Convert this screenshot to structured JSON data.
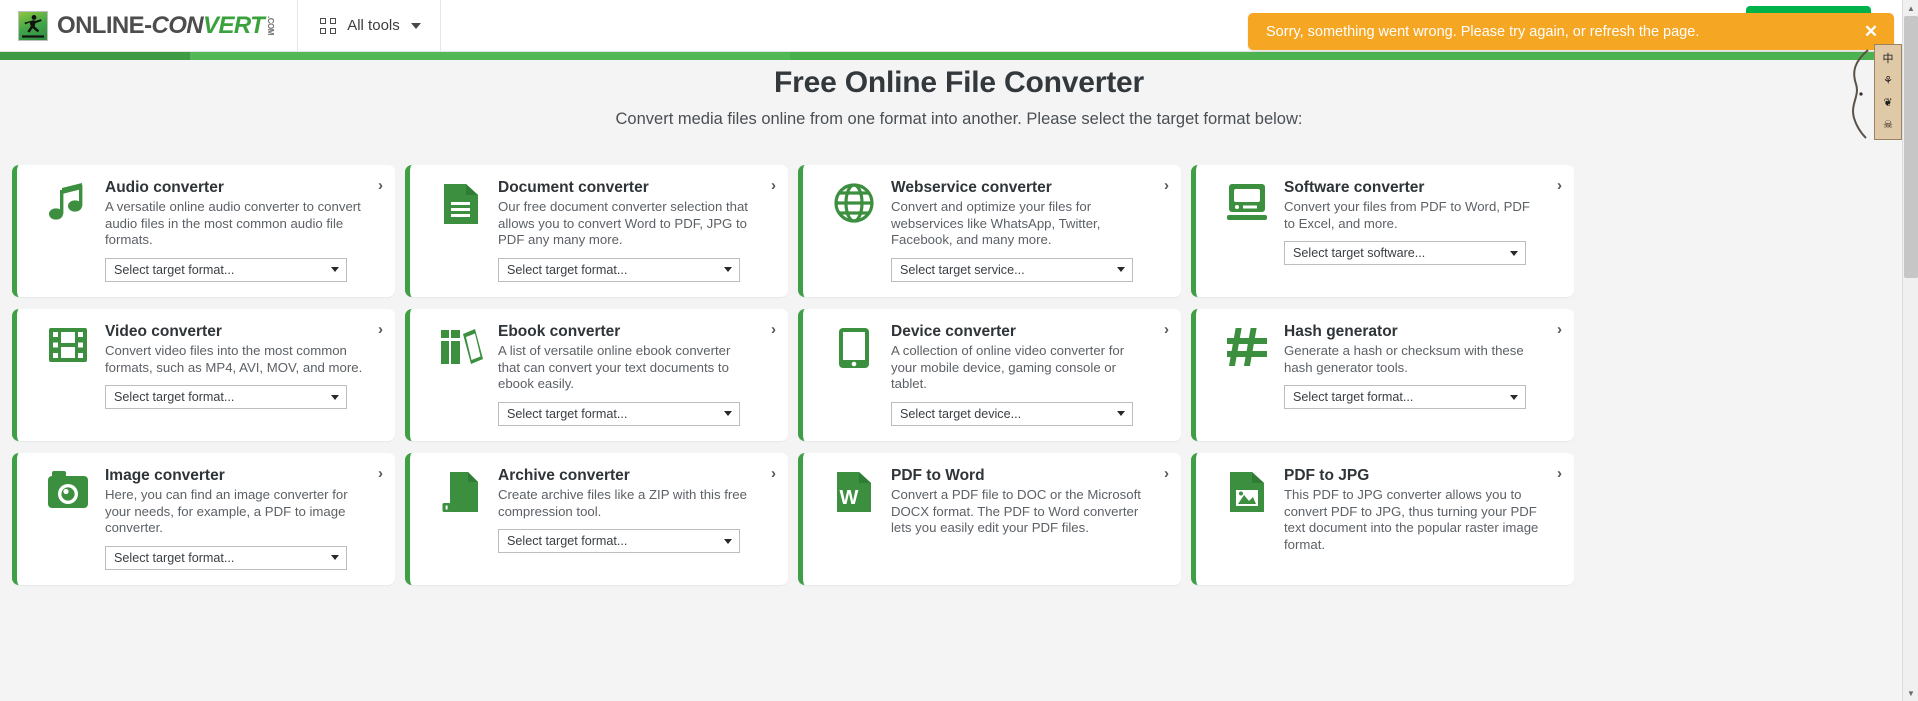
{
  "header": {
    "brand_part1": "ONLINE",
    "brand_dash": "-",
    "brand_part2": "CONVERT",
    "brand_tld": ".COM",
    "logo_icon": "runner-logo-icon",
    "all_tools_label": "All tools",
    "all_tools_icon": "grid-icon",
    "all_tools_caret": "chevron-down-icon"
  },
  "toast": {
    "message": "Sorry, something went wrong. Please try again, or refresh the page.",
    "close_label": "✕",
    "bg_color": "#f5a623",
    "text_color": "#ffffff"
  },
  "hero": {
    "title": "Free Online File Converter",
    "subtitle": "Convert media files online from one format into another. Please select the target format below:"
  },
  "theme": {
    "accent_green": "#3f9f45",
    "icon_green": "#3c8f3f",
    "page_bg": "#f4f4f4",
    "card_bg": "#ffffff"
  },
  "cards": [
    {
      "title": "Audio converter",
      "description": "A versatile online audio converter to convert audio files in the most common audio file formats.",
      "select_label": "Select target format...",
      "has_select": true,
      "icon": "music-note-icon",
      "arrow": "chevron-right-icon"
    },
    {
      "title": "Document converter",
      "description": "Our free document converter selection that allows you to convert Word to PDF, JPG to PDF any many more.",
      "select_label": "Select target format...",
      "has_select": true,
      "icon": "document-lines-icon",
      "arrow": "chevron-right-icon"
    },
    {
      "title": "Webservice converter",
      "description": "Convert and optimize your files for webservices like WhatsApp, Twitter, Facebook, and many more.",
      "select_label": "Select target service...",
      "has_select": true,
      "icon": "globe-icon",
      "arrow": "chevron-right-icon"
    },
    {
      "title": "Software converter",
      "description": "Convert your files from PDF to Word, PDF to Excel, and more.",
      "select_label": "Select target software...",
      "has_select": true,
      "icon": "desktop-computer-icon",
      "arrow": "chevron-right-icon"
    },
    {
      "title": "Video converter",
      "description": "Convert video files into the most common formats, such as MP4, AVI, MOV, and more.",
      "select_label": "Select target format...",
      "has_select": true,
      "icon": "film-strip-icon",
      "arrow": "chevron-right-icon"
    },
    {
      "title": "Ebook converter",
      "description": "A list of versatile online ebook converter that can convert your text documents to ebook easily.",
      "select_label": "Select target format...",
      "has_select": true,
      "icon": "books-icon",
      "arrow": "chevron-right-icon"
    },
    {
      "title": "Device converter",
      "description": "A collection of online video converter for your mobile device, gaming console or tablet.",
      "select_label": "Select target device...",
      "has_select": true,
      "icon": "tablet-device-icon",
      "arrow": "chevron-right-icon"
    },
    {
      "title": "Hash generator",
      "description": "Generate a hash or checksum with these hash generator tools.",
      "select_label": "Select target format...",
      "has_select": true,
      "icon": "hash-icon",
      "arrow": "chevron-right-icon"
    },
    {
      "title": "Image converter",
      "description": "Here, you can find an image converter for your needs, for example, a PDF to image converter.",
      "select_label": "Select target format...",
      "has_select": true,
      "icon": "camera-icon",
      "arrow": "chevron-right-icon"
    },
    {
      "title": "Archive converter",
      "description": "Create archive files like a ZIP with this free compression tool.",
      "select_label": "Select target format...",
      "has_select": true,
      "icon": "archive-zip-icon",
      "arrow": "chevron-right-icon"
    },
    {
      "title": "PDF to Word",
      "description": "Convert a PDF file to DOC or the Microsoft DOCX format. The PDF to Word converter lets you easily edit your PDF files.",
      "select_label": "",
      "has_select": false,
      "icon": "word-document-icon",
      "arrow": "chevron-right-icon"
    },
    {
      "title": "PDF to JPG",
      "description": "This PDF to JPG converter allows you to convert PDF to JPG, thus turning your PDF text document into the popular raster image format.",
      "select_label": "",
      "has_select": false,
      "icon": "image-document-icon",
      "arrow": "chevron-right-icon"
    }
  ],
  "scrollbar": {
    "up_arrow": "▲",
    "down_arrow": "▼"
  },
  "widget": {
    "glyph1": "中",
    "glyph2": "⚘",
    "glyph3": "❦",
    "glyph4": "☠"
  }
}
